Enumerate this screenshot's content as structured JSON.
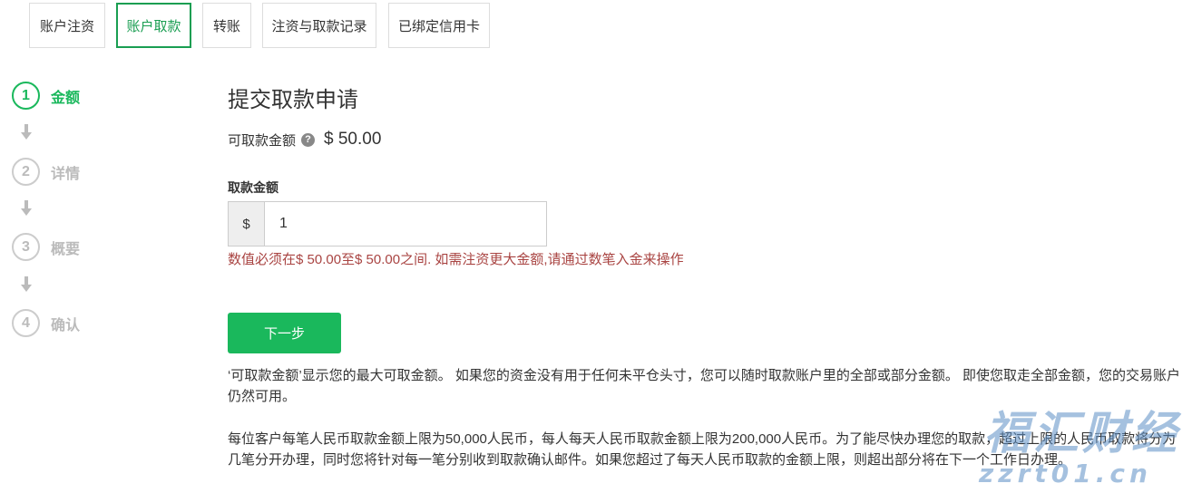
{
  "tabs": [
    {
      "label": "账户注资",
      "active": false
    },
    {
      "label": "账户取款",
      "active": true
    },
    {
      "label": "转账",
      "active": false
    },
    {
      "label": "注资与取款记录",
      "active": false
    },
    {
      "label": "已绑定信用卡",
      "active": false
    }
  ],
  "steps": [
    {
      "number": "1",
      "label": "金额",
      "active": true
    },
    {
      "number": "2",
      "label": "详情",
      "active": false
    },
    {
      "number": "3",
      "label": "概要",
      "active": false
    },
    {
      "number": "4",
      "label": "确认",
      "active": false
    }
  ],
  "form": {
    "title": "提交取款申请",
    "available_label": "可取款金额",
    "available_amount": "$ 50.00",
    "amount_label": "取款金额",
    "currency_symbol": "$",
    "amount_value": "1",
    "error_message": "数值必须在$ 50.00至$ 50.00之间. 如需注资更大金额,请通过数笔入金来操作",
    "next_button": "下一步"
  },
  "info": {
    "paragraph1": "‘可取款金额’显示您的最大可取金额。 如果您的资金没有用于任何未平仓头寸，您可以随时取款账户里的全部或部分金额。 即使您取走全部金额，您的交易账户仍然可用。",
    "paragraph2": "每位客户每笔人民币取款金额上限为50,000人民币，每人每天人民币取款金额上限为200,000人民币。为了能尽快办理您的取款，超过上限的人民币取款将分为几笔分开办理，同时您将针对每一笔分别收到取款确认邮件。如果您超过了每天人民币取款的金额上限，则超出部分将在下一个工作日办理。"
  },
  "watermark": {
    "text_top": "福汇财经",
    "text_bottom": "zzrt01.cn"
  },
  "colors": {
    "accent": "#1ab85c",
    "tab_active": "#1a9e52",
    "error": "#a94442",
    "watermark": "#5c8fc6"
  }
}
